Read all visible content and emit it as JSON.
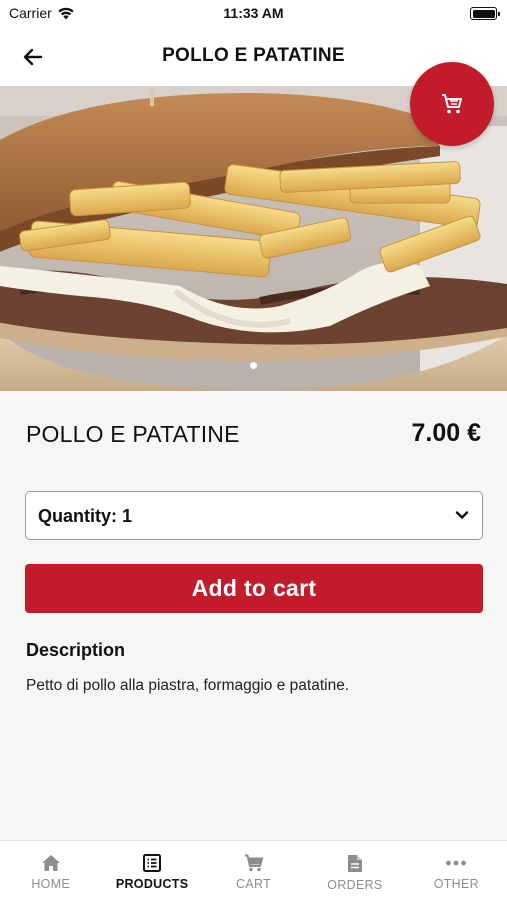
{
  "status_bar": {
    "carrier": "Carrier",
    "time": "11:33 AM"
  },
  "header": {
    "title": "POLLO E PATATINE",
    "back_icon": "arrow-left-icon"
  },
  "hero": {
    "image": "sandwich with fries, steak and cheese",
    "slide_count": 1,
    "active_slide": 1,
    "cart_icon": "cart-icon"
  },
  "product": {
    "name": "POLLO E PATATINE",
    "price": "7.00 €",
    "quantity_label": "Quantity: 1",
    "add_to_cart": "Add to cart",
    "description_heading": "Description",
    "description": "Petto di pollo alla piastra, formaggio e patatine."
  },
  "tabs": [
    {
      "label": "HOME",
      "icon": "home-icon",
      "active": false
    },
    {
      "label": "PRODUCTS",
      "icon": "list-icon",
      "active": true
    },
    {
      "label": "CART",
      "icon": "cart-icon",
      "active": false
    },
    {
      "label": "ORDERS",
      "icon": "document-icon",
      "active": false
    },
    {
      "label": "OTHER",
      "icon": "more-icon",
      "active": false
    }
  ],
  "colors": {
    "accent": "#c21b2a",
    "background": "#f6f6f6",
    "inactive_tab": "#8d8d8d"
  }
}
